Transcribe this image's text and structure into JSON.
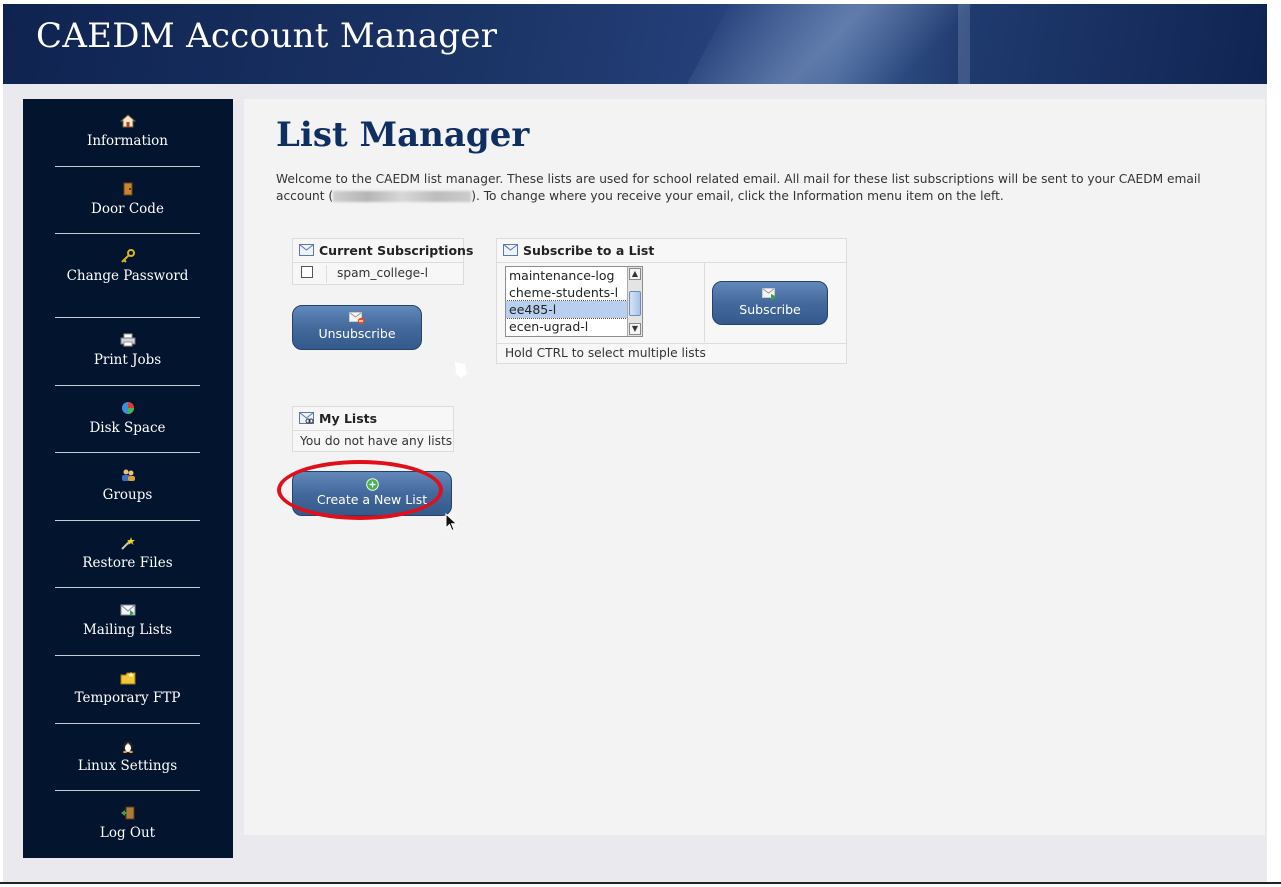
{
  "app": {
    "title": "CAEDM Account Manager"
  },
  "sidebar": {
    "items": [
      {
        "label": "Information",
        "icon": "home-icon"
      },
      {
        "label": "Door Code",
        "icon": "door-icon"
      },
      {
        "label": "Change Password",
        "icon": "key-icon"
      },
      {
        "label": "Print Jobs",
        "icon": "printer-icon"
      },
      {
        "label": "Disk Space",
        "icon": "pie-chart-icon"
      },
      {
        "label": "Groups",
        "icon": "users-icon"
      },
      {
        "label": "Restore Files",
        "icon": "magic-wand-icon"
      },
      {
        "label": "Mailing Lists",
        "icon": "mail-icon"
      },
      {
        "label": "Temporary FTP",
        "icon": "folder-icon"
      },
      {
        "label": "Linux Settings",
        "icon": "penguin-icon"
      },
      {
        "label": "Log Out",
        "icon": "exit-door-icon"
      }
    ]
  },
  "main": {
    "title": "List Manager",
    "intro_part1": "Welcome to the CAEDM list manager. These lists are used for school related email. All mail for these list subscriptions will be sent to your CAEDM email account (",
    "intro_part2": "). To change where you receive your email, click the Information menu item on the left."
  },
  "current_subscriptions": {
    "heading": "Current Subscriptions",
    "items": [
      {
        "name": "spam_college-l",
        "checked": false
      }
    ],
    "unsubscribe_label": "Unsubscribe"
  },
  "subscribe": {
    "heading": "Subscribe to a List",
    "options": [
      "maintenance-log",
      "cheme-students-l",
      "ee485-l",
      "ecen-ugrad-l"
    ],
    "selected": "ee485-l",
    "button_label": "Subscribe",
    "hint": "Hold CTRL to select multiple lists"
  },
  "my_lists": {
    "heading": "My Lists",
    "empty_text": "You do not have any lists",
    "create_label": "Create a New List"
  },
  "colors": {
    "sidebar_bg": "#02142e",
    "title": "#0f2f63",
    "button": "#44699c",
    "annotation": "#e0101a"
  }
}
